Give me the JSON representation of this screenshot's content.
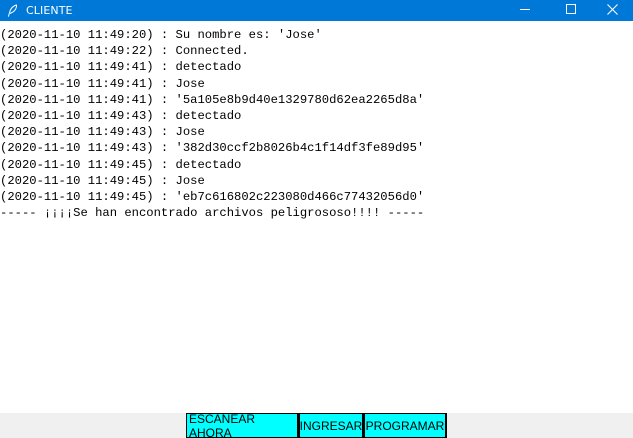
{
  "window": {
    "title": "CLIENTE",
    "app_icon": "feather-icon",
    "title_bar_color": "#0078d7",
    "controls": [
      "minimize-icon",
      "maximize-icon",
      "close-icon"
    ]
  },
  "output": {
    "lines": [
      "(2020-11-10 11:49:20) : Su nombre es: 'Jose'",
      "(2020-11-10 11:49:22) : Connected.",
      "(2020-11-10 11:49:41) : detectado",
      "(2020-11-10 11:49:41) : Jose",
      "(2020-11-10 11:49:41) : '5a105e8b9d40e1329780d62ea2265d8a'",
      "(2020-11-10 11:49:43) : detectado",
      "(2020-11-10 11:49:43) : Jose",
      "(2020-11-10 11:49:43) : '382d30ccf2b8026b4c1f14df3fe89d95'",
      "(2020-11-10 11:49:45) : detectado",
      "(2020-11-10 11:49:45) : Jose",
      "(2020-11-10 11:49:45) : 'eb7c616802c223080d466c77432056d0'",
      "----- ¡¡¡¡Se han encontrado archivos peligrososo!!!! -----"
    ]
  },
  "buttons": {
    "scan_now": "ESCANEAR AHORA",
    "ingresar": "INGRESAR",
    "programar": "PROGRAMAR",
    "color": "#00ffff"
  }
}
